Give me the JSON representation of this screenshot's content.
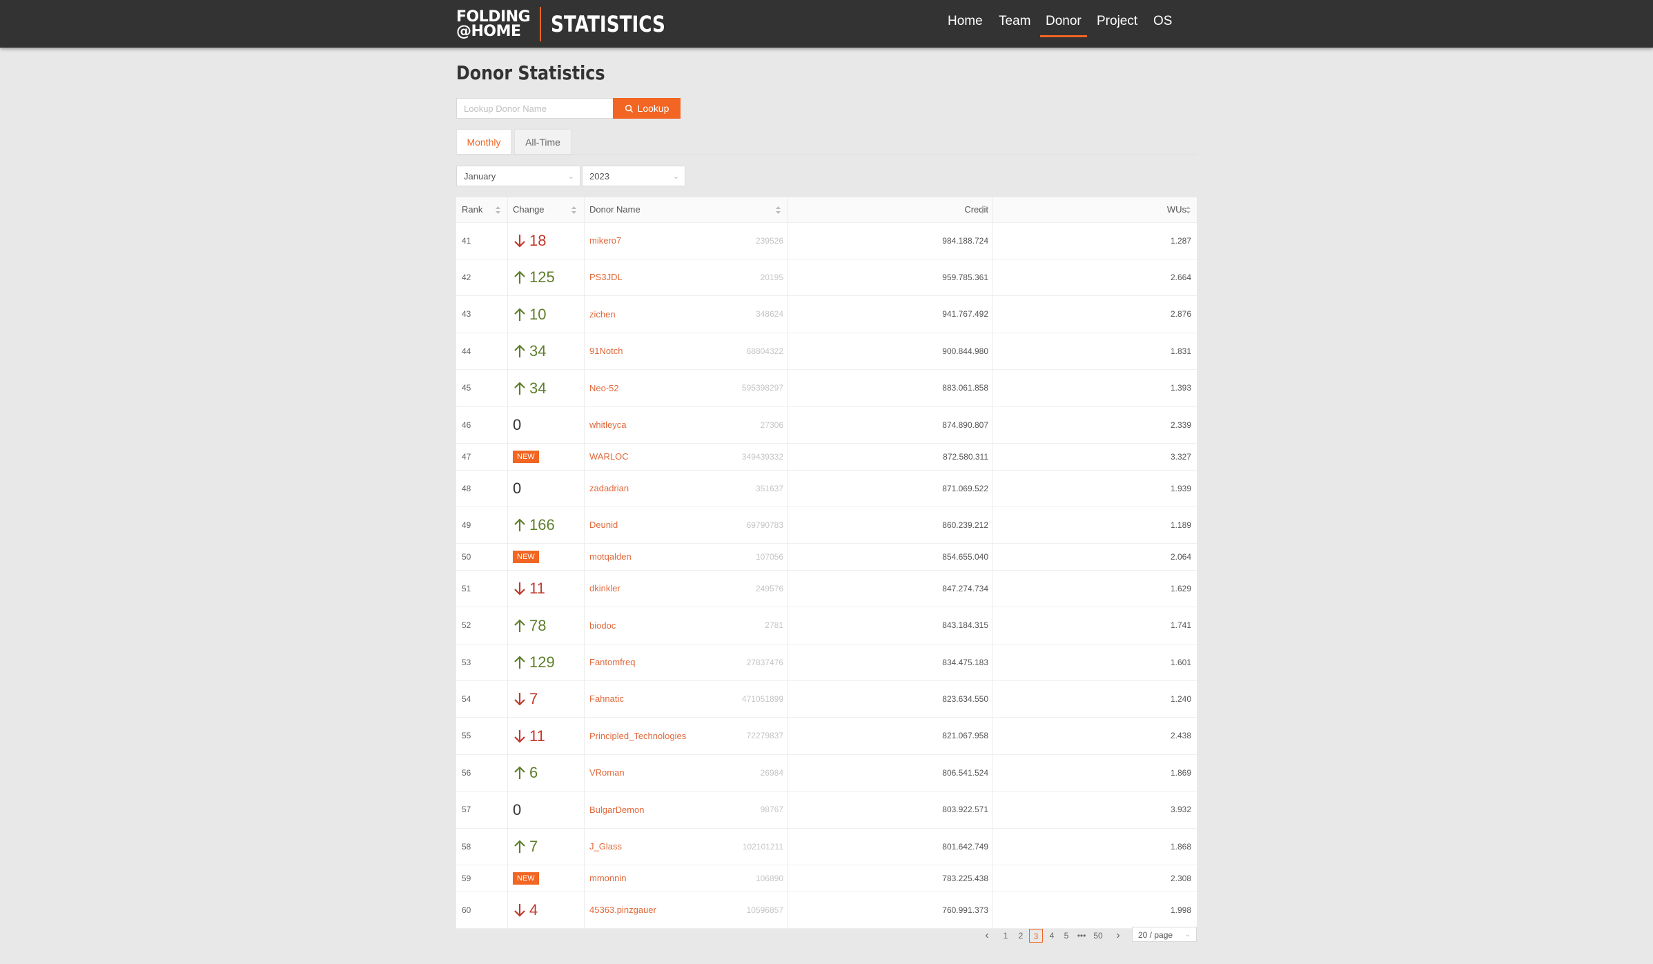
{
  "header": {
    "logo_line1": "FOLDING",
    "logo_line2": "@HOME",
    "logo_title": "STATISTICS",
    "nav": [
      "Home",
      "Team",
      "Donor",
      "Project",
      "OS"
    ],
    "active_nav": "Donor"
  },
  "page": {
    "title": "Donor Statistics",
    "search_placeholder": "Lookup Donor Name",
    "lookup_label": "Lookup",
    "tabs": [
      "Monthly",
      "All-Time"
    ],
    "active_tab": "Monthly",
    "month": "January",
    "year": "2023"
  },
  "table": {
    "columns": [
      "Rank",
      "Change",
      "Donor Name",
      "Credit",
      "WUs"
    ],
    "rows": [
      {
        "rank": "41",
        "change": "18",
        "dir": "down",
        "name": "mikero7",
        "id": "239526",
        "credit": "984.188.724",
        "wus": "1.287"
      },
      {
        "rank": "42",
        "change": "125",
        "dir": "up",
        "name": "PS3JDL",
        "id": "20195",
        "credit": "959.785.361",
        "wus": "2.664"
      },
      {
        "rank": "43",
        "change": "10",
        "dir": "up",
        "name": "zichen",
        "id": "348624",
        "credit": "941.767.492",
        "wus": "2.876"
      },
      {
        "rank": "44",
        "change": "34",
        "dir": "up",
        "name": "91Notch",
        "id": "68804322",
        "credit": "900.844.980",
        "wus": "1.831"
      },
      {
        "rank": "45",
        "change": "34",
        "dir": "up",
        "name": "Neo-52",
        "id": "595398297",
        "credit": "883.061.858",
        "wus": "1.393"
      },
      {
        "rank": "46",
        "change": "0",
        "dir": "same",
        "name": "whitleyca",
        "id": "27306",
        "credit": "874.890.807",
        "wus": "2.339"
      },
      {
        "rank": "47",
        "change": "NEW",
        "dir": "new",
        "name": "WARLOC",
        "id": "349439332",
        "credit": "872.580.311",
        "wus": "3.327"
      },
      {
        "rank": "48",
        "change": "0",
        "dir": "same",
        "name": "zadadrian",
        "id": "351637",
        "credit": "871.069.522",
        "wus": "1.939"
      },
      {
        "rank": "49",
        "change": "166",
        "dir": "up",
        "name": "Deunid",
        "id": "69790783",
        "credit": "860.239.212",
        "wus": "1.189"
      },
      {
        "rank": "50",
        "change": "NEW",
        "dir": "new",
        "name": "motqalden",
        "id": "107056",
        "credit": "854.655.040",
        "wus": "2.064"
      },
      {
        "rank": "51",
        "change": "11",
        "dir": "down",
        "name": "dkinkler",
        "id": "249576",
        "credit": "847.274.734",
        "wus": "1.629"
      },
      {
        "rank": "52",
        "change": "78",
        "dir": "up",
        "name": "biodoc",
        "id": "2781",
        "credit": "843.184.315",
        "wus": "1.741"
      },
      {
        "rank": "53",
        "change": "129",
        "dir": "up",
        "name": "Fantomfreq",
        "id": "27837476",
        "credit": "834.475.183",
        "wus": "1.601"
      },
      {
        "rank": "54",
        "change": "7",
        "dir": "down",
        "name": "Fahnatic",
        "id": "471051899",
        "credit": "823.634.550",
        "wus": "1.240"
      },
      {
        "rank": "55",
        "change": "11",
        "dir": "down",
        "name": "Principled_Technologies",
        "id": "72279837",
        "credit": "821.067.958",
        "wus": "2.438"
      },
      {
        "rank": "56",
        "change": "6",
        "dir": "up",
        "name": "VRoman",
        "id": "26984",
        "credit": "806.541.524",
        "wus": "1.869"
      },
      {
        "rank": "57",
        "change": "0",
        "dir": "same",
        "name": "BulgarDemon",
        "id": "98767",
        "credit": "803.922.571",
        "wus": "3.932"
      },
      {
        "rank": "58",
        "change": "7",
        "dir": "up",
        "name": "J_Glass",
        "id": "102101211",
        "credit": "801.642.749",
        "wus": "1.868"
      },
      {
        "rank": "59",
        "change": "NEW",
        "dir": "new",
        "name": "mmonnin",
        "id": "106890",
        "credit": "783.225.438",
        "wus": "2.308"
      },
      {
        "rank": "60",
        "change": "4",
        "dir": "down",
        "name": "45363.pinzgauer",
        "id": "10596857",
        "credit": "760.991.373",
        "wus": "1.998"
      }
    ]
  },
  "pagination": {
    "pages": [
      "1",
      "2",
      "3",
      "4",
      "5",
      "•••",
      "50"
    ],
    "current": "3",
    "page_size": "20 / page"
  },
  "colors": {
    "accent": "#f26522",
    "up": "#5e7f2c",
    "down": "#c0392b",
    "header_bg": "#333333"
  }
}
